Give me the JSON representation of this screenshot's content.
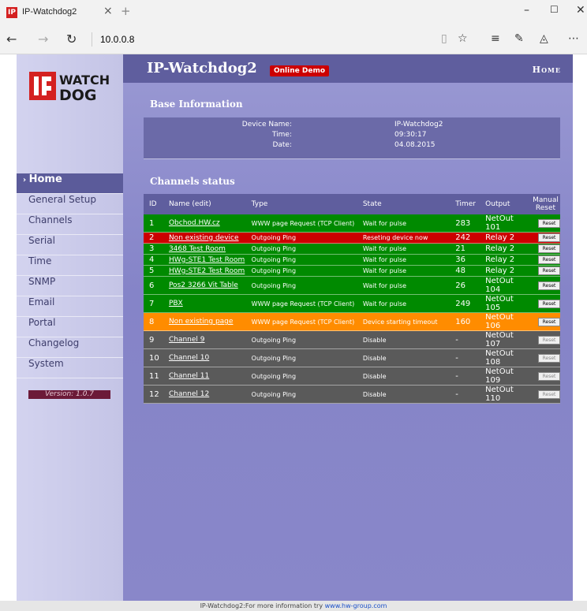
{
  "browser": {
    "tab_title": "IP-Watchdog2",
    "url": "10.0.0.8",
    "favicon_text": "IP"
  },
  "header": {
    "title": "IP-Watchdog2",
    "demo_badge": "Online Demo",
    "home_link": "Home"
  },
  "logo": {
    "top": "WATCH",
    "bottom": "DOG",
    "mark": "IP"
  },
  "sidebar": {
    "items": [
      {
        "label": "Home",
        "active": true
      },
      {
        "label": "General Setup"
      },
      {
        "label": "Channels"
      },
      {
        "label": "Serial"
      },
      {
        "label": "Time"
      },
      {
        "label": "SNMP"
      },
      {
        "label": "Email"
      },
      {
        "label": "Portal"
      },
      {
        "label": "Changelog"
      },
      {
        "label": "System"
      }
    ],
    "version": "Version: 1.0.7"
  },
  "base_info": {
    "title": "Base Information",
    "rows": [
      {
        "label": "Device Name:",
        "value": "IP-Watchdog2"
      },
      {
        "label": "Time:",
        "value": "09:30:17"
      },
      {
        "label": "Date:",
        "value": "04.08.2015"
      }
    ]
  },
  "channels": {
    "title": "Channels status",
    "headers": {
      "id": "ID",
      "name": "Name (edit)",
      "type": "Type",
      "state": "State",
      "timer": "Timer",
      "output": "Output",
      "manual": "Manual",
      "reset": "Reset"
    },
    "reset_label": "Reset",
    "rows": [
      {
        "id": "1",
        "name": "Obchod.HW.cz",
        "type": "WWW page Request (TCP Client)",
        "state": "Wait for pulse",
        "timer": "283",
        "output": "NetOut 101",
        "color": "#008a00"
      },
      {
        "id": "2",
        "name": "Non existing device",
        "type": "Outgoing Ping",
        "state": "Reseting device now",
        "timer": "242",
        "output": "Relay 2",
        "color": "#cc0000"
      },
      {
        "id": "3",
        "name": "3468 Test Room",
        "type": "Outgoing Ping",
        "state": "Wait for pulse",
        "timer": "21",
        "output": "Relay 2",
        "color": "#008a00"
      },
      {
        "id": "4",
        "name": "HWg-STE1 Test Room",
        "type": "Outgoing Ping",
        "state": "Wait for pulse",
        "timer": "36",
        "output": "Relay 2",
        "color": "#008a00"
      },
      {
        "id": "5",
        "name": "HWg-STE2 Test Room",
        "type": "Outgoing Ping",
        "state": "Wait for pulse",
        "timer": "48",
        "output": "Relay 2",
        "color": "#008a00"
      },
      {
        "id": "6",
        "name": "Pos2 3266 Vit Table",
        "type": "Outgoing Ping",
        "state": "Wait for pulse",
        "timer": "26",
        "output": "NetOut 104",
        "color": "#008a00"
      },
      {
        "id": "7",
        "name": "PBX",
        "type": "WWW page Request (TCP Client)",
        "state": "Wait for pulse",
        "timer": "249",
        "output": "NetOut 105",
        "color": "#008a00"
      },
      {
        "id": "8",
        "name": "Non existing page",
        "type": "WWW page Request (TCP Client)",
        "state": "Device starting timeout",
        "timer": "160",
        "output": "NetOut 106",
        "color": "#ff8c00"
      },
      {
        "id": "9",
        "name": "Channel 9",
        "type": "Outgoing Ping",
        "state": "Disable",
        "timer": "-",
        "output": "NetOut 107",
        "color": "#5a5a5a"
      },
      {
        "id": "10",
        "name": "Channel 10",
        "type": "Outgoing Ping",
        "state": "Disable",
        "timer": "-",
        "output": "NetOut 108",
        "color": "#5a5a5a"
      },
      {
        "id": "11",
        "name": "Channel 11",
        "type": "Outgoing Ping",
        "state": "Disable",
        "timer": "-",
        "output": "NetOut 109",
        "color": "#5a5a5a"
      },
      {
        "id": "12",
        "name": "Channel 12",
        "type": "Outgoing Ping",
        "state": "Disable",
        "timer": "-",
        "output": "NetOut 110",
        "color": "#5a5a5a"
      }
    ]
  },
  "footer": {
    "text": "IP-Watchdog2:For more information try ",
    "link": "www.hw-group.com"
  }
}
